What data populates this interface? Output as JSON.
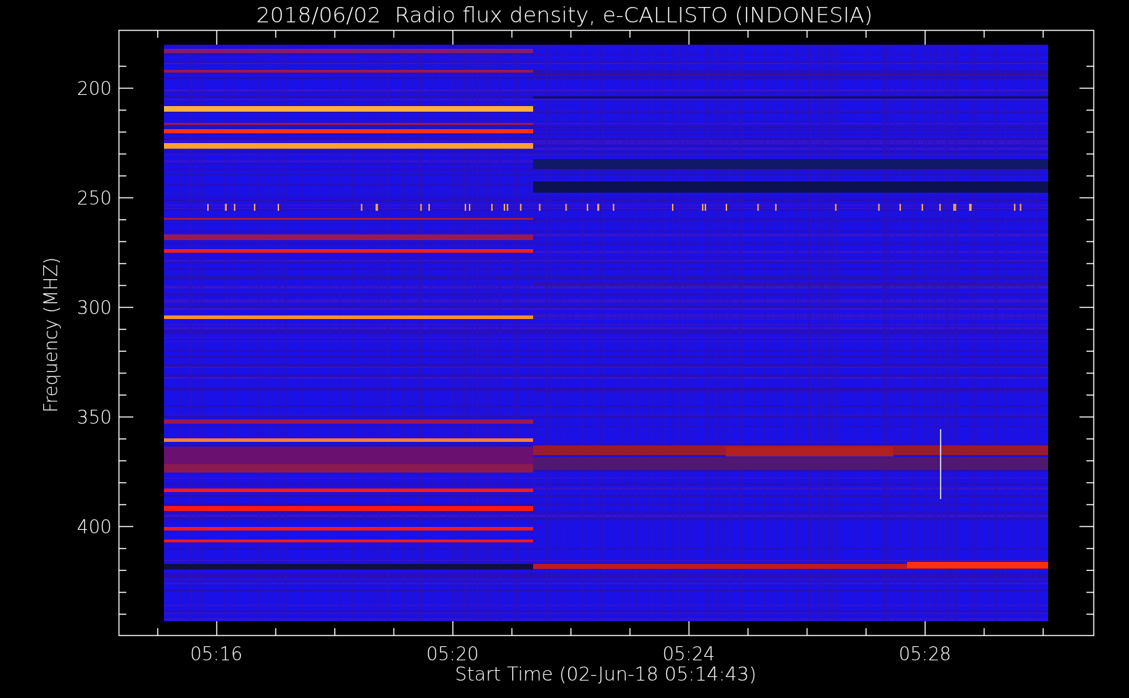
{
  "title": "2018/06/02  Radio flux density, e-CALLISTO (INDONESIA)",
  "y_axis": {
    "label": "Frequency (MHZ)",
    "ticks": [
      "200",
      "250",
      "300",
      "350",
      "400"
    ]
  },
  "x_axis": {
    "label": "Start Time (02-Jun-18 05:14:43)",
    "ticks": [
      "05:16",
      "05:20",
      "05:24",
      "05:28"
    ]
  }
}
